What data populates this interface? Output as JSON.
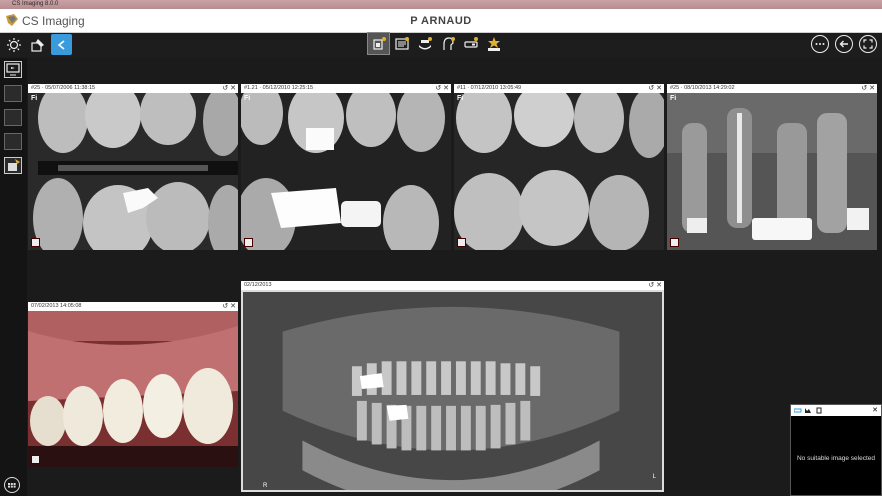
{
  "window": {
    "title": "CS Imaging 8.0.0"
  },
  "app": {
    "brand": "CS Imaging",
    "patient": "P   ARNAUD"
  },
  "toolbar": {
    "left_tools": [
      "brightness-icon",
      "paint-icon",
      "collapse-icon"
    ],
    "center_tools": [
      "acquire-intraoral-icon",
      "report-icon",
      "panoramic-icon",
      "cephalometric-icon",
      "scanner-icon",
      "new-icon"
    ],
    "right_tools": [
      "more-icon",
      "back-icon",
      "fullscreen-icon"
    ]
  },
  "panels": [
    {
      "id": "p1",
      "header": "#25 · 05/07/2006 11:38:15",
      "fi": "Fi"
    },
    {
      "id": "p2",
      "header": "#1.21 · 05/12/2010 12:25:15",
      "fi": "Fi"
    },
    {
      "id": "p3",
      "header": "#11 · 07/12/2010 13:05:49",
      "fi": "Fi"
    },
    {
      "id": "p4",
      "header": "#25 · 08/10/2013 14:29:02",
      "fi": "Fi"
    },
    {
      "id": "p5",
      "header": "07/02/2013 14:05:08",
      "fi": ""
    },
    {
      "id": "p6",
      "header": "02/12/2013",
      "fi": "",
      "corner_left": "R",
      "corner_right": "L"
    }
  ],
  "mini_panel": {
    "message": "No suitable image selected"
  },
  "colors": {
    "accent": "#3a9bdc",
    "background": "#1b1b1b",
    "header": "#ffffff"
  }
}
